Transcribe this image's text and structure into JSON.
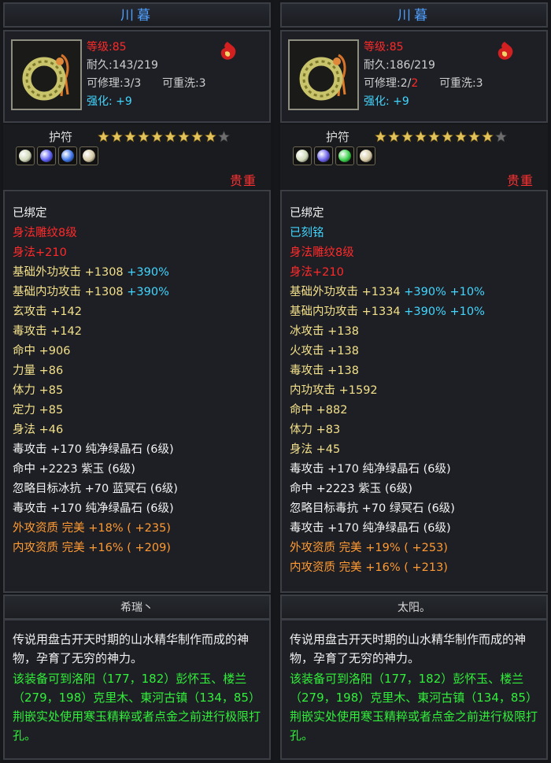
{
  "left": {
    "name": "川暮",
    "level": "等级:85",
    "durability": "耐久:143/219",
    "repair": "可修理:3/3",
    "rewash": "可重洗:3",
    "enhance_label": "强化:",
    "enhance_value": "+9",
    "category": "护符",
    "stars_filled": 9,
    "stars_total": 10,
    "gems": [
      "#cfd7b8",
      "#5a5cf0",
      "#3e74e6",
      "#d4c9a4"
    ],
    "grade": "贵重",
    "stats": [
      {
        "text": "已绑定",
        "color": "white"
      },
      {
        "text": "身法雕纹8级",
        "color": "red"
      },
      {
        "text": "身法+210",
        "color": "red"
      },
      {
        "text": "基础外功攻击 +1308",
        "extra": "+390%",
        "color": "yellow"
      },
      {
        "text": "基础内功攻击 +1308",
        "extra": "+390%",
        "color": "yellow"
      },
      {
        "text": "玄攻击 +142",
        "color": "yellow"
      },
      {
        "text": "毒攻击 +142",
        "color": "yellow"
      },
      {
        "text": "命中 +906",
        "color": "yellow"
      },
      {
        "text": "力量 +86",
        "color": "yellow"
      },
      {
        "text": "体力 +85",
        "color": "yellow"
      },
      {
        "text": "定力 +85",
        "color": "yellow"
      },
      {
        "text": "身法 +46",
        "color": "yellow"
      },
      {
        "text": "毒攻击 +170 纯净绿晶石 (6级)",
        "color": "white"
      },
      {
        "text": "命中 +2223 紫玉 (6级)",
        "color": "white"
      },
      {
        "text": "忽略目标冰抗 +70 蓝冥石 (6级)",
        "color": "white"
      },
      {
        "text": "毒攻击 +170 纯净绿晶石 (6级)",
        "color": "white"
      },
      {
        "text": "外攻资质 完美 +18% ( +235)",
        "color": "orange"
      },
      {
        "text": "内攻资质 完美 +16% ( +209)",
        "color": "orange"
      }
    ],
    "owner": "希瑞丶",
    "desc_white": "传说用盘古开天时期的山水精华制作而成的神物，孕育了无穷的神力。",
    "desc_green": "该装备可到洛阳（177，182）彭怀玉、楼兰（279，198）克里木、東河古镇（134，85）荆嵌实处使用寒玉精粹或者点金之前进行极限打孔。"
  },
  "right": {
    "name": "川暮",
    "level": "等级:85",
    "durability": "耐久:186/219",
    "repair_prefix": "可修理:2/",
    "repair_suffix": "2",
    "rewash": "可重洗:3",
    "enhance_label": "强化:",
    "enhance_value": "+9",
    "category": "护符",
    "stars_filled": 9,
    "stars_total": 10,
    "gems": [
      "#cfd7b8",
      "#6a5fe8",
      "#39d04a",
      "#d4c9a4"
    ],
    "grade": "贵重",
    "stats": [
      {
        "text": "已绑定",
        "color": "white"
      },
      {
        "text": "已刻铭",
        "color": "cyan"
      },
      {
        "text": "身法雕纹8级",
        "color": "red"
      },
      {
        "text": "身法+210",
        "color": "red"
      },
      {
        "text": "基础外功攻击 +1334",
        "extra": "+390% +10%",
        "color": "yellow"
      },
      {
        "text": "基础内功攻击 +1334",
        "extra": "+390% +10%",
        "color": "yellow"
      },
      {
        "text": "冰攻击 +138",
        "color": "yellow"
      },
      {
        "text": "火攻击 +138",
        "color": "yellow"
      },
      {
        "text": "毒攻击 +138",
        "color": "yellow"
      },
      {
        "text": "内功攻击 +1592",
        "color": "yellow"
      },
      {
        "text": "命中 +882",
        "color": "yellow"
      },
      {
        "text": "体力 +83",
        "color": "yellow"
      },
      {
        "text": "身法 +45",
        "color": "yellow"
      },
      {
        "text": "毒攻击 +170 纯净绿晶石 (6级)",
        "color": "white"
      },
      {
        "text": "命中 +2223 紫玉 (6级)",
        "color": "white"
      },
      {
        "text": "忽略目标毒抗 +70 绿冥石 (6级)",
        "color": "white"
      },
      {
        "text": "毒攻击 +170 纯净绿晶石 (6级)",
        "color": "white"
      },
      {
        "text": "外攻资质 完美 +19% ( +253)",
        "color": "orange"
      },
      {
        "text": "内攻资质 完美 +16% ( +213)",
        "color": "orange"
      }
    ],
    "owner": "太阳。",
    "desc_white": "传说用盘古开天时期的山水精华制作而成的神物，孕育了无穷的神力。",
    "desc_green": "该装备可到洛阳（177，182）彭怀玉、楼兰（279，198）克里木、東河古镇（134，85）荆嵌实处使用寒玉精粹或者点金之前进行极限打孔。"
  }
}
